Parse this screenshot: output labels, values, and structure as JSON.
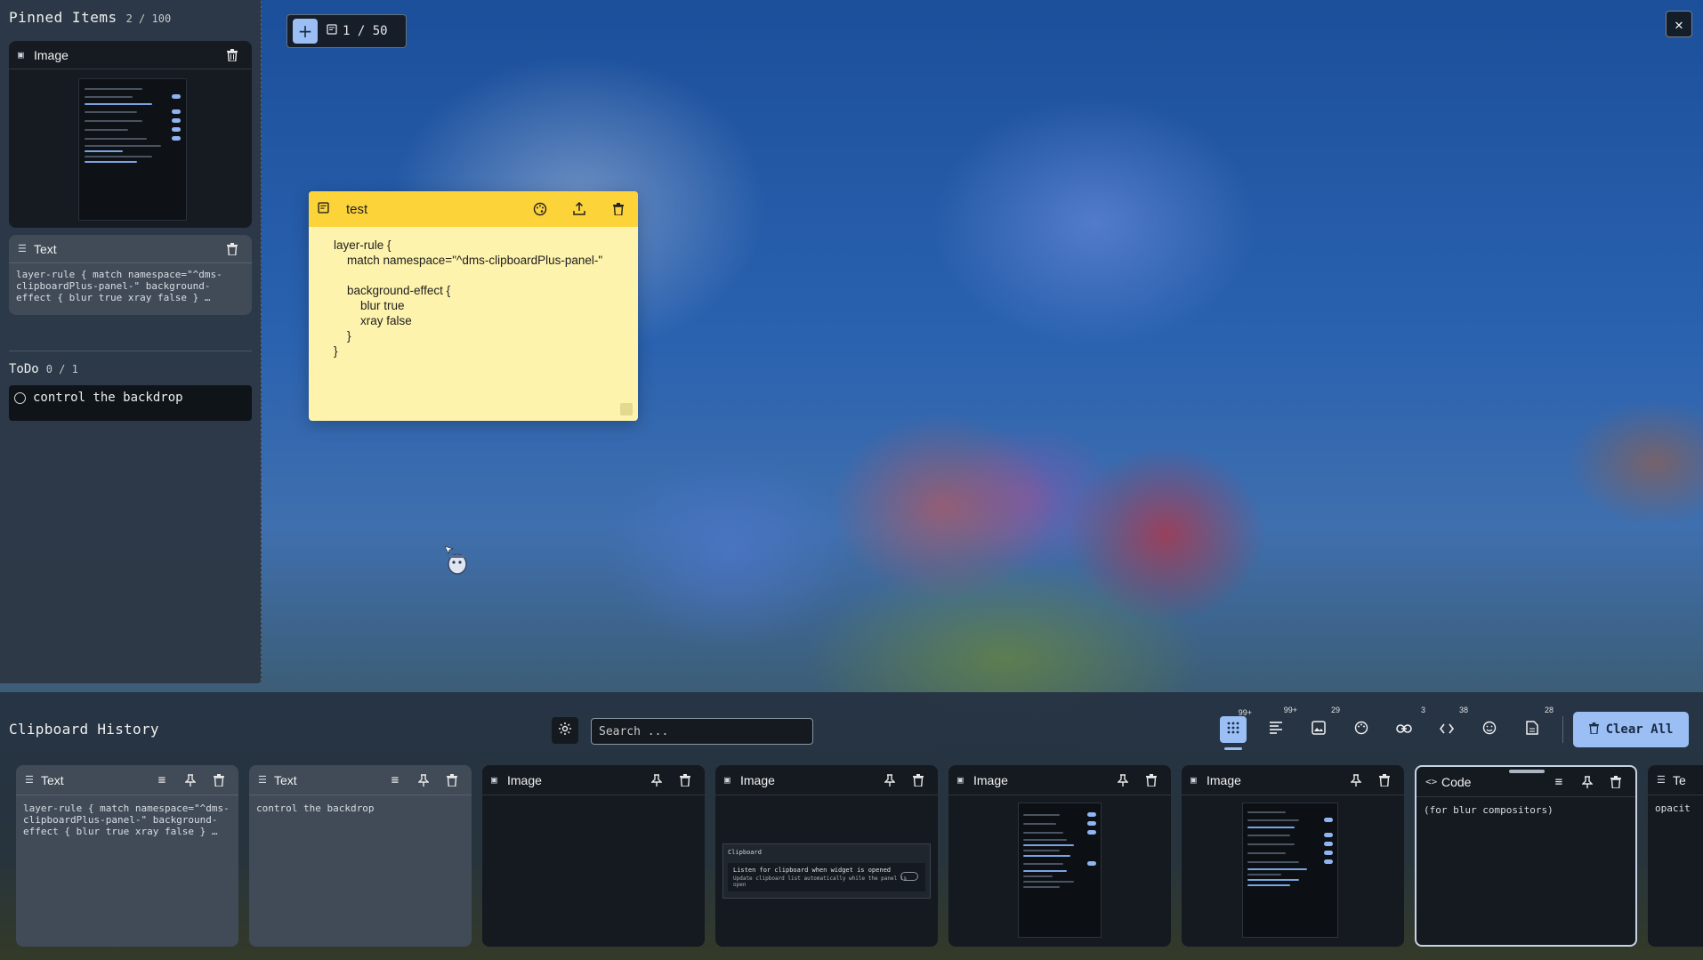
{
  "pinned": {
    "title": "Pinned Items",
    "count": "2 / 100",
    "items": [
      {
        "type": "Image"
      },
      {
        "type": "Text",
        "content": "layer-rule { match namespace=\"^dms-clipboardPlus-panel-\" background-effect { blur true xray false } …"
      }
    ]
  },
  "todo": {
    "title": "ToDo",
    "count": "0 / 1",
    "items": [
      {
        "text": "control the backdrop"
      }
    ]
  },
  "notes": {
    "count": "1 / 50",
    "note": {
      "title": "test",
      "body": "layer-rule {\n    match namespace=\"^dms-clipboardPlus-panel-\"\n\n    background-effect {\n        blur true\n        xray false\n    }\n}"
    }
  },
  "history": {
    "title": "Clipboard History",
    "search_placeholder": "Search ...",
    "clear_label": "Clear All",
    "tabs": [
      {
        "icon": "grid-icon",
        "badge": "99+",
        "active": true
      },
      {
        "icon": "text-lines-icon",
        "badge": "99+"
      },
      {
        "icon": "image-icon",
        "badge": "29"
      },
      {
        "icon": "palette-icon",
        "badge": ""
      },
      {
        "icon": "link-icon",
        "badge": "3"
      },
      {
        "icon": "code-icon",
        "badge": "38"
      },
      {
        "icon": "emoji-icon",
        "badge": ""
      },
      {
        "icon": "file-icon",
        "badge": "28"
      }
    ],
    "cards": [
      {
        "type": "Text",
        "content": "layer-rule { match namespace=\"^dms-clipboardPlus-panel-\" background-effect { blur true xray false } …"
      },
      {
        "type": "Text",
        "content": "control the backdrop"
      },
      {
        "type": "Image"
      },
      {
        "type": "Image",
        "dialog_title": "Clipboard",
        "dialog_main": "Listen for clipboard when widget is opened",
        "dialog_sub": "Update clipboard list automatically while the panel is open"
      },
      {
        "type": "Image"
      },
      {
        "type": "Image"
      },
      {
        "type": "Code",
        "content": "(for blur compositors)"
      },
      {
        "type": "Te",
        "content": "opacit"
      }
    ]
  },
  "colors": {
    "accent": "#9bbff5",
    "note_header": "#fdd33a",
    "note_body": "#fdf3ad",
    "panel": "#2d3744"
  }
}
